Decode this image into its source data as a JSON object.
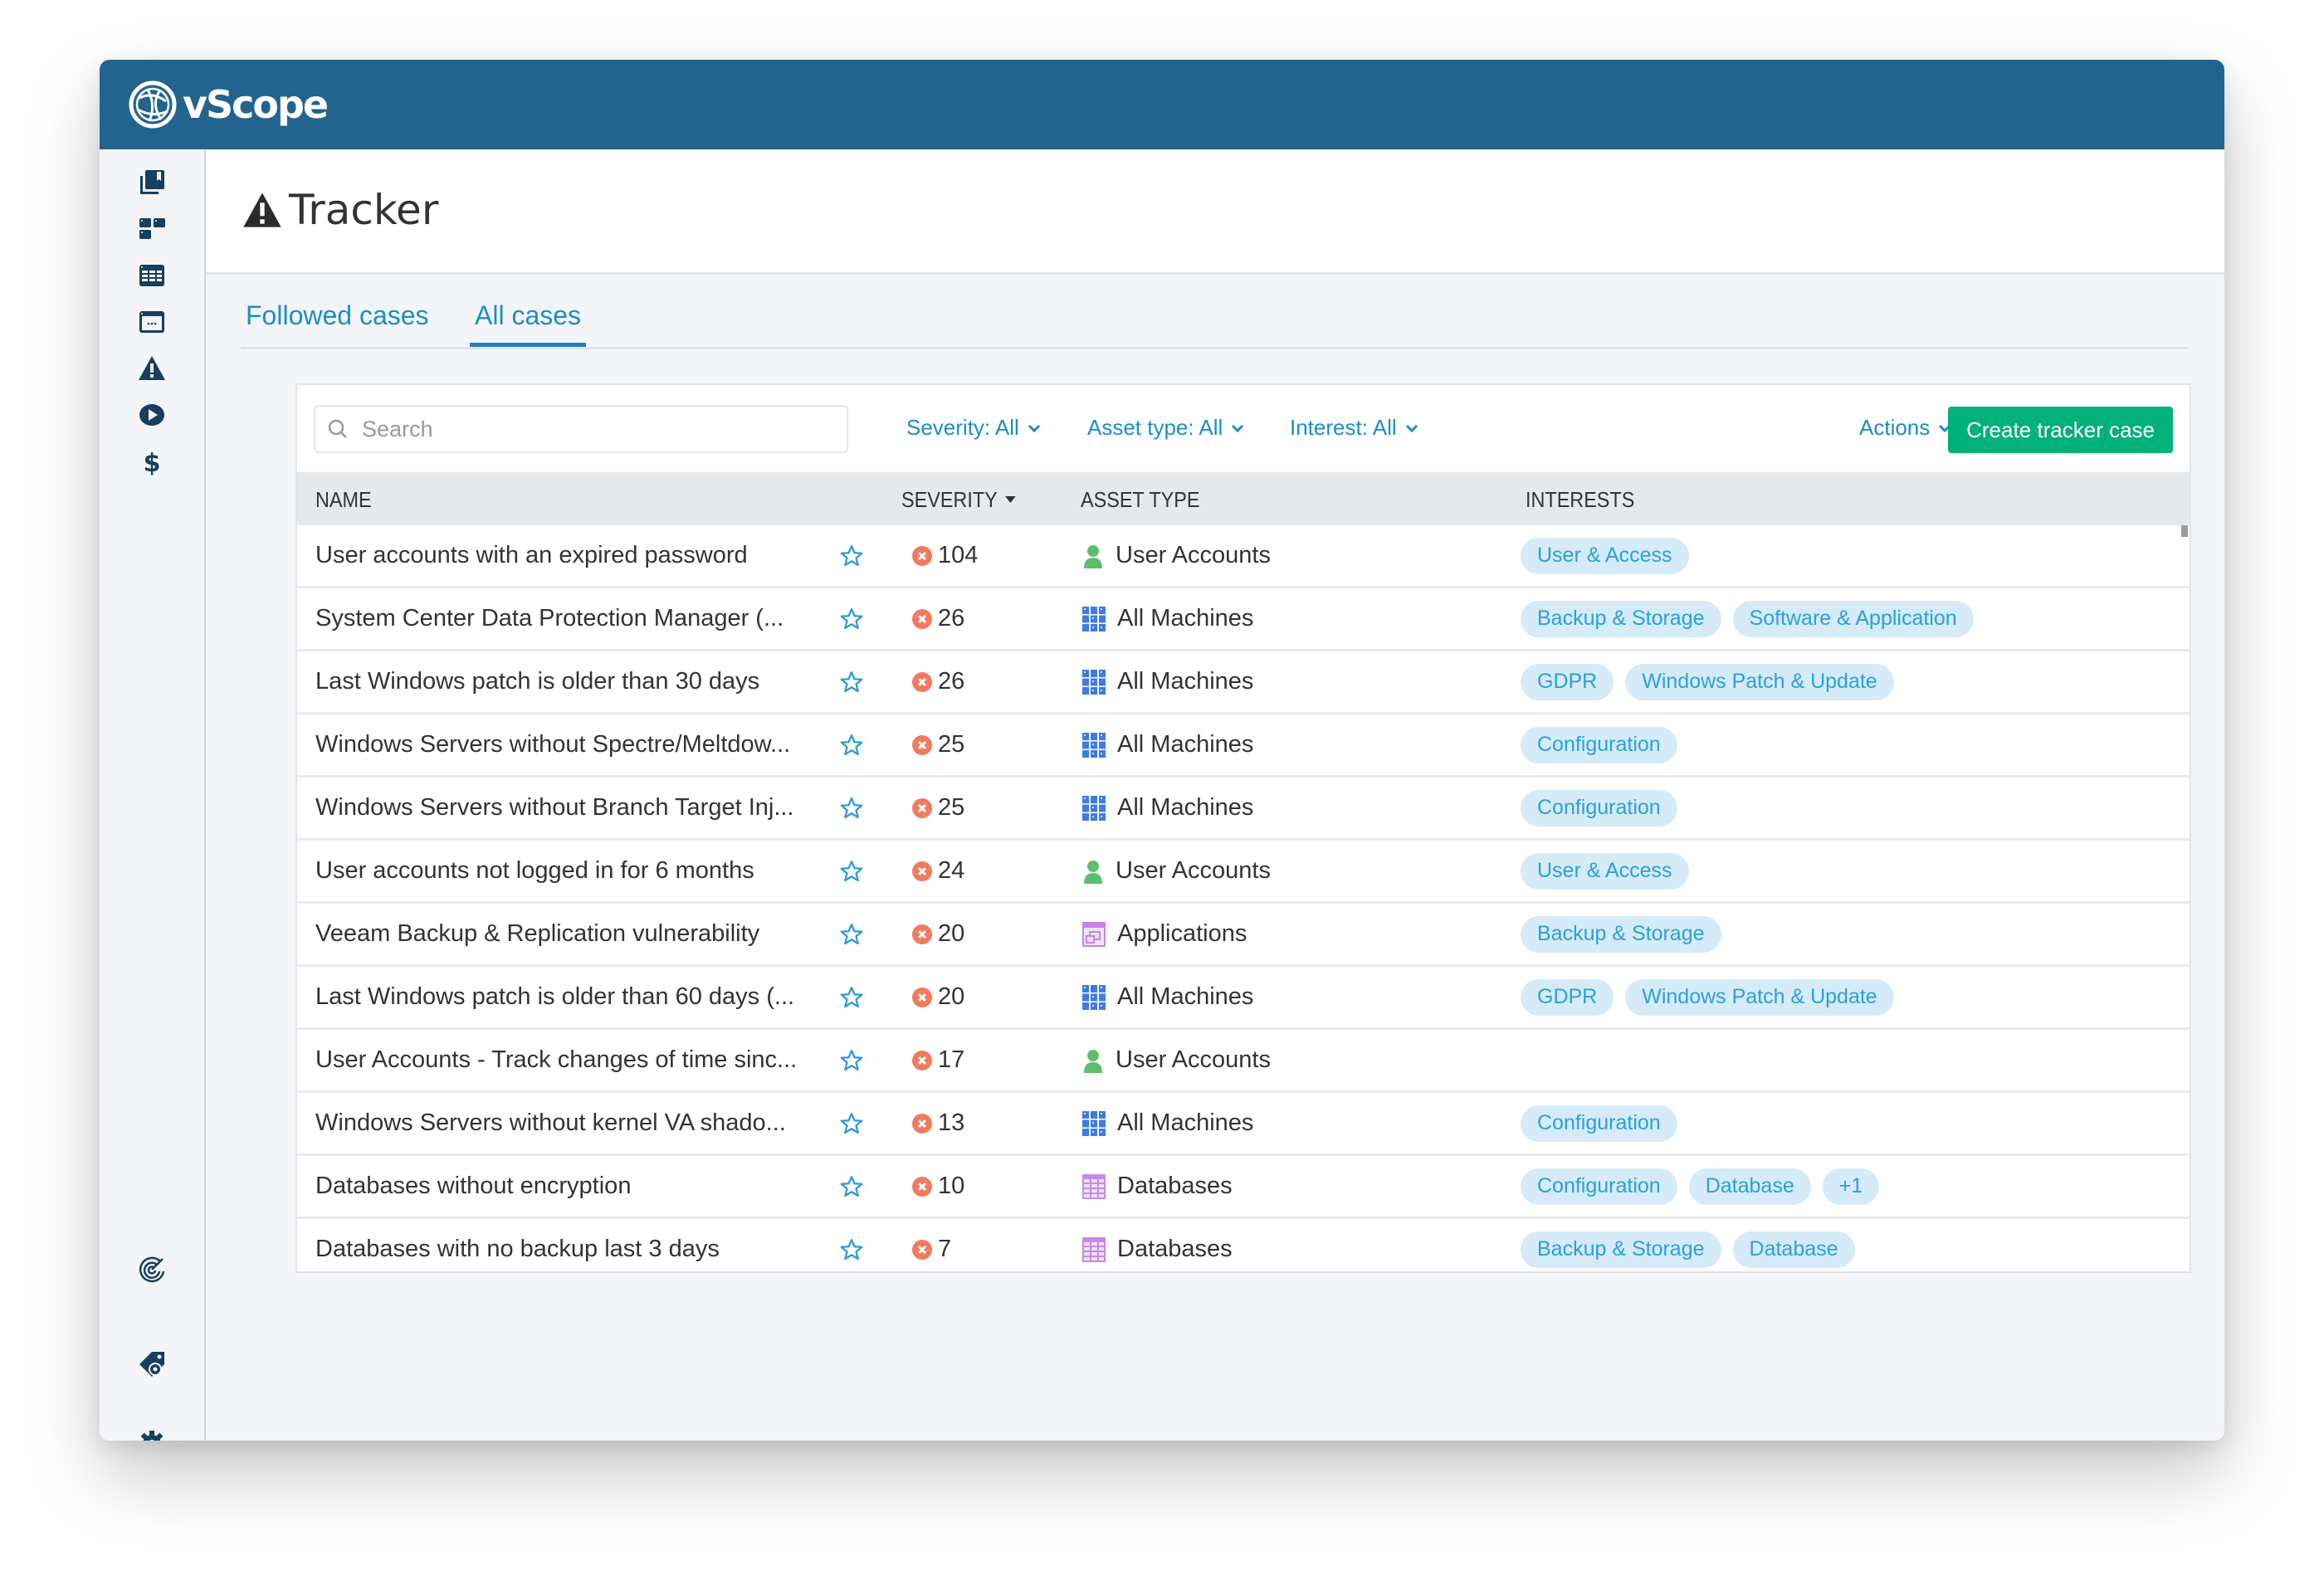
{
  "app": {
    "name": "vScope",
    "brand_color": "#23648f",
    "accent_color": "#1b8ec7",
    "primary_button_color": "#00b17a"
  },
  "sidebar": {
    "items": [
      {
        "icon": "collections-icon"
      },
      {
        "icon": "dashboard-icon"
      },
      {
        "icon": "table-icon"
      },
      {
        "icon": "window-icon"
      },
      {
        "icon": "warning-icon"
      },
      {
        "icon": "play-icon"
      },
      {
        "icon": "dollar-icon"
      }
    ],
    "bottom_items": [
      {
        "icon": "radar-icon"
      },
      {
        "icon": "tag-settings-icon"
      },
      {
        "icon": "gear-icon"
      }
    ]
  },
  "page": {
    "title": "Tracker",
    "title_icon": "warning-icon"
  },
  "tabs": [
    {
      "label": "Followed cases",
      "active": false
    },
    {
      "label": "All cases",
      "active": true
    }
  ],
  "toolbar": {
    "search_placeholder": "Search",
    "search_value": "",
    "filters": [
      {
        "label": "Severity: All"
      },
      {
        "label": "Asset type: All"
      },
      {
        "label": "Interest: All"
      }
    ],
    "actions_label": "Actions",
    "create_label": "Create tracker case"
  },
  "table": {
    "columns": {
      "name": "NAME",
      "severity": "SEVERITY",
      "asset_type": "ASSET TYPE",
      "interests": "INTERESTS"
    },
    "sort": {
      "column": "severity",
      "direction": "desc"
    },
    "rows": [
      {
        "name": "User accounts with an expired password",
        "severity": "104",
        "asset_type": "User Accounts",
        "asset_icon": "user",
        "interests": [
          "User & Access"
        ]
      },
      {
        "name": "System Center Data Protection Manager (...",
        "severity": "26",
        "asset_type": "All Machines",
        "asset_icon": "machines",
        "interests": [
          "Backup & Storage",
          "Software & Application"
        ]
      },
      {
        "name": "Last Windows patch is older than 30 days",
        "severity": "26",
        "asset_type": "All Machines",
        "asset_icon": "machines",
        "interests": [
          "GDPR",
          "Windows Patch & Update"
        ]
      },
      {
        "name": "Windows Servers without Spectre/Meltdow...",
        "severity": "25",
        "asset_type": "All Machines",
        "asset_icon": "machines",
        "interests": [
          "Configuration"
        ]
      },
      {
        "name": "Windows Servers without Branch Target Inj...",
        "severity": "25",
        "asset_type": "All Machines",
        "asset_icon": "machines",
        "interests": [
          "Configuration"
        ]
      },
      {
        "name": "User accounts not logged in for 6 months",
        "severity": "24",
        "asset_type": "User Accounts",
        "asset_icon": "user",
        "interests": [
          "User & Access"
        ]
      },
      {
        "name": "Veeam Backup & Replication vulnerability",
        "severity": "20",
        "asset_type": "Applications",
        "asset_icon": "applications",
        "interests": [
          "Backup & Storage"
        ]
      },
      {
        "name": "Last Windows patch is older than 60 days (...",
        "severity": "20",
        "asset_type": "All Machines",
        "asset_icon": "machines",
        "interests": [
          "GDPR",
          "Windows Patch & Update"
        ]
      },
      {
        "name": "User Accounts - Track changes of time sinc...",
        "severity": "17",
        "asset_type": "User Accounts",
        "asset_icon": "user",
        "interests": []
      },
      {
        "name": "Windows Servers without kernel VA shado...",
        "severity": "13",
        "asset_type": "All Machines",
        "asset_icon": "machines",
        "interests": [
          "Configuration"
        ]
      },
      {
        "name": "Databases without encryption",
        "severity": "10",
        "asset_type": "Databases",
        "asset_icon": "databases",
        "interests": [
          "Configuration",
          "Database",
          "+1"
        ]
      },
      {
        "name": "Databases with no backup last 3 days",
        "severity": "7",
        "asset_type": "Databases",
        "asset_icon": "databases",
        "interests": [
          "Backup & Storage",
          "Database"
        ]
      }
    ]
  }
}
